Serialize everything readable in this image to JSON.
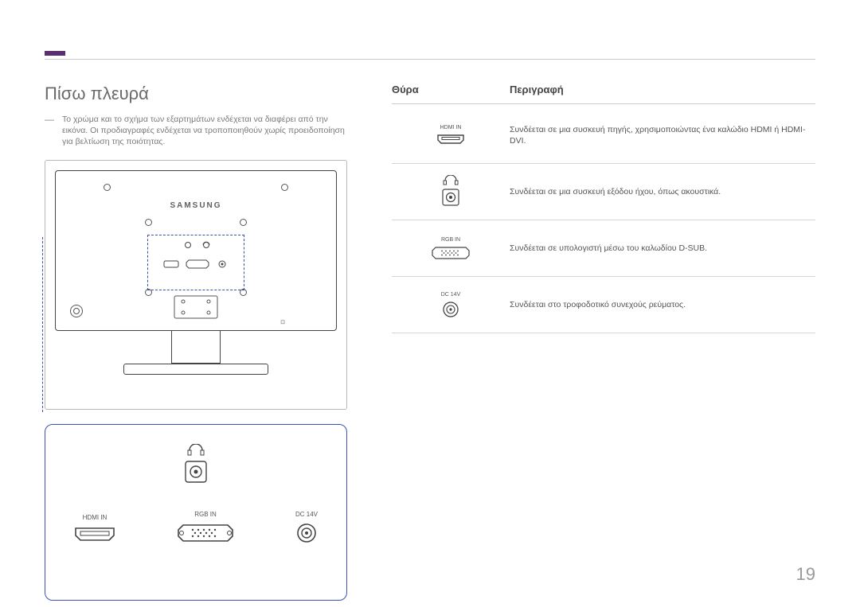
{
  "page": {
    "title": "Πίσω πλευρά",
    "note": "Το χρώμα και το σχήμα των εξαρτημάτων ενδέχεται να διαφέρει από την εικόνα. Οι προδιαγραφές ενδέχεται να τροποποιηθούν χωρίς προειδοποίηση για βελτίωση της ποιότητας.",
    "brand": "SAMSUNG",
    "page_number": "19"
  },
  "table": {
    "header_port": "Θύρα",
    "header_desc": "Περιγραφή",
    "rows": [
      {
        "label": "HDMI IN",
        "desc": "Συνδέεται σε μια συσκευή πηγής, χρησιμοποιώντας ένα καλώδιο HDMI ή HDMI-DVI."
      },
      {
        "label": "",
        "desc": "Συνδέεται σε μια συσκευή εξόδου ήχου, όπως ακουστικά."
      },
      {
        "label": "RGB IN",
        "desc": "Συνδέεται σε υπολογιστή μέσω του καλωδίου D-SUB."
      },
      {
        "label": "DC 14V",
        "desc": "Συνδέεται στο τροφοδοτικό συνεχούς ρεύματος."
      }
    ]
  },
  "zoom_labels": {
    "hdmi": "HDMI IN",
    "rgb": "RGB IN",
    "dc": "DC 14V"
  }
}
